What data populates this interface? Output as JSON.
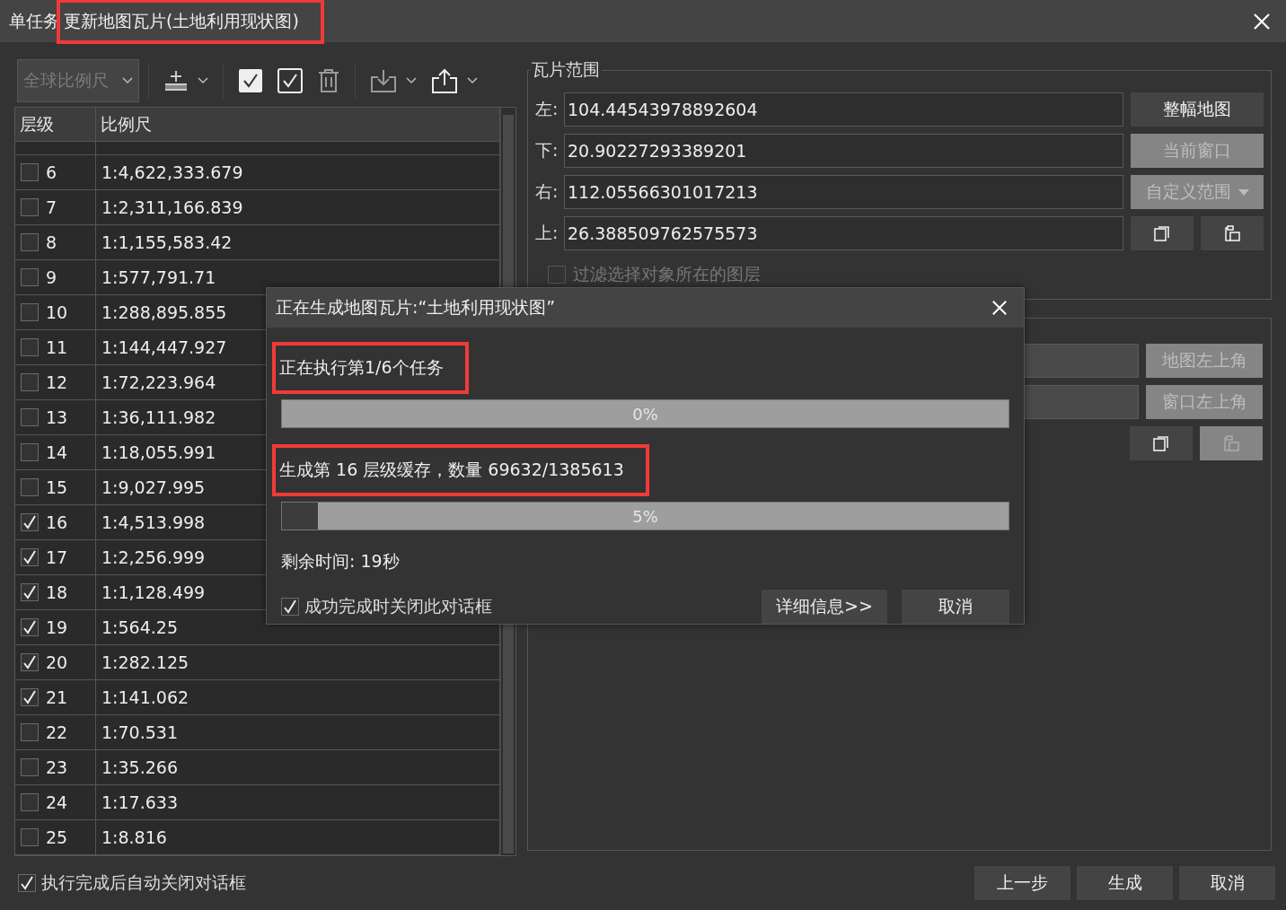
{
  "window": {
    "title_prefix": "单任务",
    "title": "更新地图瓦片(土地利用现状图)",
    "title_highlighted": true
  },
  "toolbar": {
    "scale_dropdown": {
      "value": "全球比例尺",
      "disabled": true
    }
  },
  "table": {
    "columns": [
      "层级",
      "比例尺"
    ],
    "rows": [
      {
        "level": "6",
        "scale": "1:4,622,333.679",
        "checked": false
      },
      {
        "level": "7",
        "scale": "1:2,311,166.839",
        "checked": false
      },
      {
        "level": "8",
        "scale": "1:1,155,583.42",
        "checked": false
      },
      {
        "level": "9",
        "scale": "1:577,791.71",
        "checked": false
      },
      {
        "level": "10",
        "scale": "1:288,895.855",
        "checked": false
      },
      {
        "level": "11",
        "scale": "1:144,447.927",
        "checked": false
      },
      {
        "level": "12",
        "scale": "1:72,223.964",
        "checked": false
      },
      {
        "level": "13",
        "scale": "1:36,111.982",
        "checked": false
      },
      {
        "level": "14",
        "scale": "1:18,055.991",
        "checked": false
      },
      {
        "level": "15",
        "scale": "1:9,027.995",
        "checked": false
      },
      {
        "level": "16",
        "scale": "1:4,513.998",
        "checked": true
      },
      {
        "level": "17",
        "scale": "1:2,256.999",
        "checked": true
      },
      {
        "level": "18",
        "scale": "1:1,128.499",
        "checked": true
      },
      {
        "level": "19",
        "scale": "1:564.25",
        "checked": true
      },
      {
        "level": "20",
        "scale": "1:282.125",
        "checked": true
      },
      {
        "level": "21",
        "scale": "1:141.062",
        "checked": true
      },
      {
        "level": "22",
        "scale": "1:70.531",
        "checked": false
      },
      {
        "level": "23",
        "scale": "1:35.266",
        "checked": false
      },
      {
        "level": "24",
        "scale": "1:17.633",
        "checked": false
      },
      {
        "level": "25",
        "scale": "1:8.816",
        "checked": false
      }
    ]
  },
  "tile_range": {
    "legend": "瓦片范围",
    "fields": [
      {
        "label": "左:",
        "value": "104.44543978892604",
        "button": {
          "label": "整幅地图",
          "disabled": false,
          "dropdown": false
        }
      },
      {
        "label": "下:",
        "value": "20.90227293389201",
        "button": {
          "label": "当前窗口",
          "disabled": true,
          "dropdown": false
        }
      },
      {
        "label": "右:",
        "value": "112.05566301017213",
        "button": {
          "label": "自定义范围",
          "disabled": true,
          "dropdown": true
        }
      },
      {
        "label": "上:",
        "value": "26.388509762575573"
      }
    ],
    "copy_disabled": false,
    "paste_disabled": false,
    "filter_checkbox": {
      "label": "过滤选择对象所在的图层",
      "checked": false,
      "disabled": true
    }
  },
  "origin": {
    "buttons": [
      {
        "label": "地图左上角",
        "disabled": true
      },
      {
        "label": "窗口左上角",
        "disabled": true
      }
    ],
    "copy_disabled": false,
    "paste_disabled": true
  },
  "footer": {
    "auto_close": {
      "label": "执行完成后自动关闭对话框",
      "checked": true
    },
    "buttons": [
      "上一步",
      "生成",
      "取消"
    ]
  },
  "progress_dialog": {
    "title": "正在生成地图瓦片:“土地利用现状图”",
    "task_text": "正在执行第1/6个任务",
    "task_highlighted": true,
    "task_progress": {
      "level": 0,
      "reading": "0%"
    },
    "cache_text": "生成第 16 层级缓存，数量 69632/1385613",
    "cache_highlighted": true,
    "cache_progress": {
      "level": 0.05,
      "reading": "5%"
    },
    "remaining": "剩余时间: 19秒",
    "close_on_success": {
      "label": "成功完成时关闭此对话框",
      "checked": true
    },
    "buttons": [
      "详细信息>>",
      "取消"
    ]
  }
}
